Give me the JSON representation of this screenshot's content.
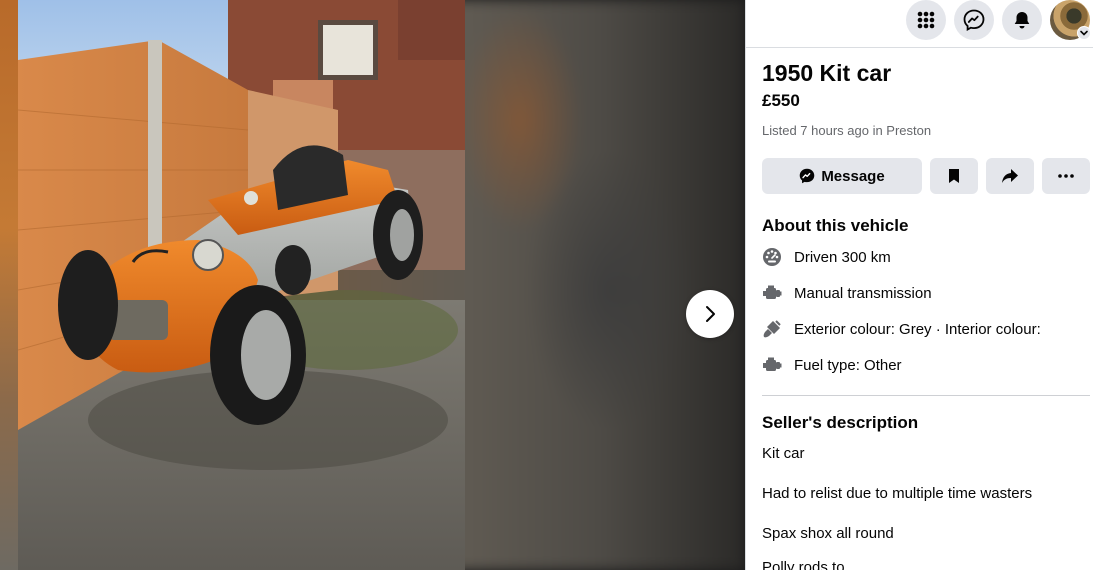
{
  "header": {
    "menu_icon": "grid-menu-icon",
    "messenger_icon": "messenger-icon",
    "notifications_icon": "bell-icon",
    "account_icon": "chevron-down-icon"
  },
  "viewer": {
    "next_icon": "chevron-right-icon"
  },
  "listing": {
    "title": "1950 Kit car",
    "price": "£550",
    "listed": "Listed 7 hours ago in Preston"
  },
  "actions": {
    "message_label": "Message",
    "message_icon": "messenger-icon",
    "save_icon": "bookmark-icon",
    "share_icon": "share-arrow-icon",
    "more_icon": "ellipsis-icon"
  },
  "about": {
    "title": "About this vehicle",
    "items": [
      {
        "icon": "speedometer-icon",
        "text": "Driven 300 km"
      },
      {
        "icon": "engine-icon",
        "text": "Manual transmission"
      },
      {
        "icon": "paint-brush-icon",
        "text": "Exterior colour: Grey · Interior colour:"
      },
      {
        "icon": "engine-icon",
        "text": "Fuel type: Other"
      }
    ]
  },
  "description": {
    "title": "Seller's description",
    "lines": [
      "Kit car",
      "Had to relist due to multiple time wasters",
      "Spax shox all round",
      "Polly rods to"
    ]
  },
  "colors": {
    "icon_gray": "#65676b",
    "button_bg": "#e4e6eb",
    "text": "#050505",
    "car_orange": "#e8741c"
  }
}
